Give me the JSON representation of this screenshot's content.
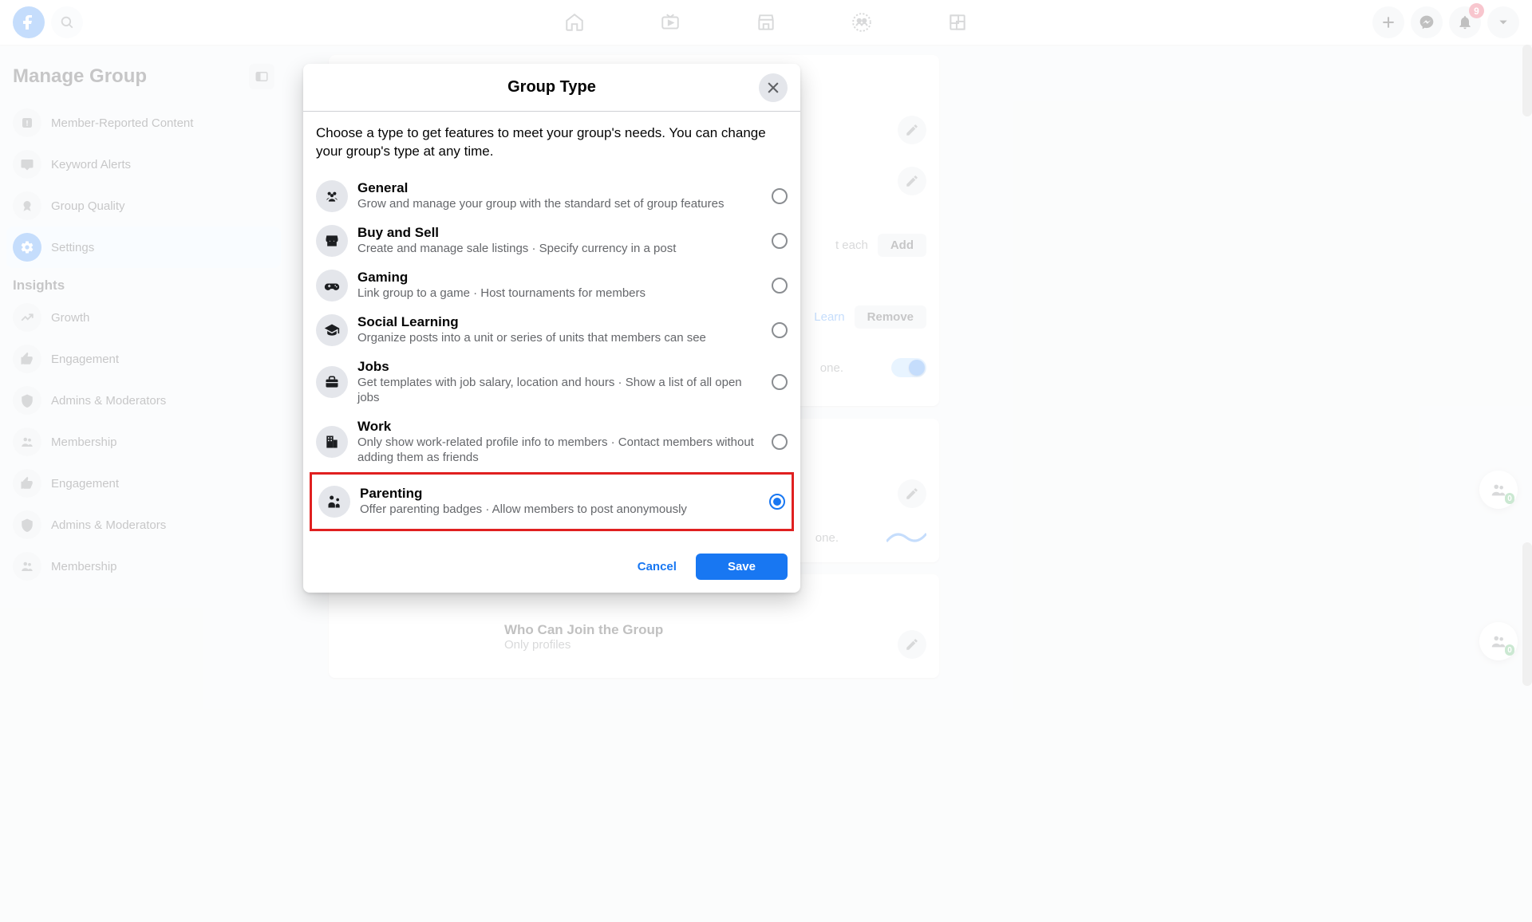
{
  "topbar": {
    "notif_badge": "9"
  },
  "sidebar": {
    "title": "Manage Group",
    "items": [
      {
        "label": "Member-Reported Content"
      },
      {
        "label": "Keyword Alerts"
      },
      {
        "label": "Group Quality"
      },
      {
        "label": "Settings"
      },
      {
        "label": "Growth"
      },
      {
        "label": "Engagement"
      },
      {
        "label": "Admins & Moderators"
      },
      {
        "label": "Membership"
      },
      {
        "label": "Engagement"
      },
      {
        "label": "Admins & Moderators"
      },
      {
        "label": "Membership"
      }
    ],
    "insights_label": "Insights"
  },
  "modal": {
    "title": "Group Type",
    "description": "Choose a type to get features to meet your group's needs. You can change your group's type at any time.",
    "types": [
      {
        "title": "General",
        "sub": "Grow and manage your group with the standard set of group features"
      },
      {
        "title": "Buy and Sell",
        "sub": "Create and manage sale listings · Specify currency in a post"
      },
      {
        "title": "Gaming",
        "sub": "Link group to a game · Host tournaments for members"
      },
      {
        "title": "Social Learning",
        "sub": "Organize posts into a unit or series of units that members can see"
      },
      {
        "title": "Jobs",
        "sub": "Get templates with job salary, location and hours · Show a list of all open jobs"
      },
      {
        "title": "Work",
        "sub": "Only show work-related profile info to members · Contact members without adding them as friends"
      },
      {
        "title": "Parenting",
        "sub": "Offer parenting badges · Allow members to post anonymously"
      }
    ],
    "cancel": "Cancel",
    "save": "Save"
  },
  "bg": {
    "t_each": "t each",
    "add": "Add",
    "learn": "Learn",
    "remove": "Remove",
    "one": "one.",
    "who_join_title": "Who Can Join the Group",
    "who_join_sub": "Only profiles",
    "float_badge": "0"
  }
}
